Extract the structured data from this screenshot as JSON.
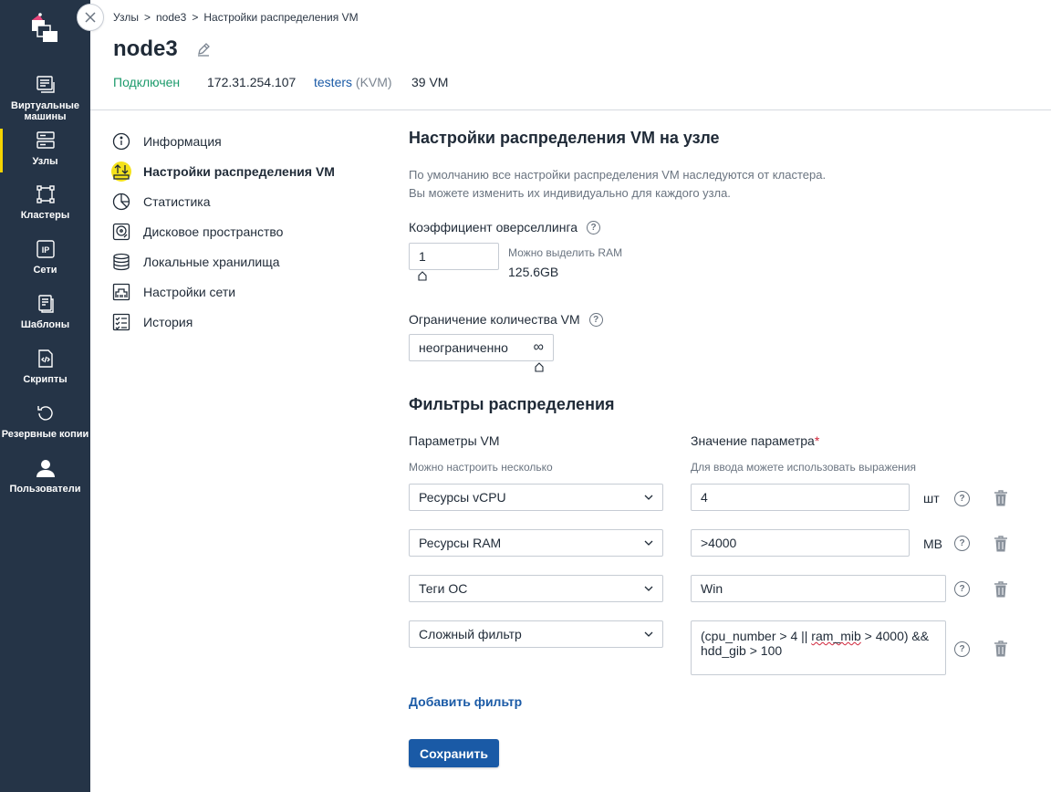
{
  "sidebar": {
    "items": [
      {
        "label": "Виртуальные машины",
        "icon": "vm-icon"
      },
      {
        "label": "Узлы",
        "icon": "nodes-icon",
        "active": true
      },
      {
        "label": "Кластеры",
        "icon": "clusters-icon"
      },
      {
        "label": "Сети",
        "icon": "ip-icon"
      },
      {
        "label": "Шаблоны",
        "icon": "templates-icon"
      },
      {
        "label": "Скрипты",
        "icon": "scripts-icon"
      },
      {
        "label": "Резервные копии",
        "icon": "backup-icon"
      },
      {
        "label": "Пользователи",
        "icon": "user-icon"
      }
    ]
  },
  "breadcrumb": {
    "items": [
      "Узлы",
      "node3",
      "Настройки распределения VM"
    ],
    "sep": ">"
  },
  "header": {
    "title": "node3",
    "status": "Подключен",
    "ip": "172.31.254.107",
    "cluster": "testers",
    "cluster_type": "(KVM)",
    "vm_count": "39 VM"
  },
  "menu": {
    "items": [
      {
        "label": "Информация",
        "icon": "info-icon"
      },
      {
        "label": "Настройки распределения VM",
        "icon": "distribution-icon",
        "active": true
      },
      {
        "label": "Статистика",
        "icon": "pie-chart-icon"
      },
      {
        "label": "Дисковое пространство",
        "icon": "disk-icon"
      },
      {
        "label": "Локальные хранилища",
        "icon": "database-icon"
      },
      {
        "label": "Настройки сети",
        "icon": "network-icon"
      },
      {
        "label": "История",
        "icon": "history-icon"
      }
    ]
  },
  "content": {
    "title": "Настройки распределения VM на узле",
    "desc_line1": "По умолчанию все настройки распределения VM наследуются от кластера.",
    "desc_line2": "Вы можете изменить их индивидуально для каждого узла.",
    "overselling_label": "Коэффициент оверселлинга",
    "overselling_value": "1",
    "ram_hint": "Можно выделить RAM",
    "ram_value": "125.6GB",
    "vm_limit_label": "Ограничение количества VM",
    "vm_limit_value": "неограниченно",
    "vm_limit_symbol": "∞",
    "filters_title": "Фильтры распределения",
    "col_params": "Параметры VM",
    "col_params_hint": "Можно настроить несколько",
    "col_value": "Значение параметра",
    "col_value_required": "*",
    "col_value_hint": "Для ввода можете использовать выражения",
    "filters": [
      {
        "param": "Ресурсы vCPU",
        "value": "4",
        "unit": "шт"
      },
      {
        "param": "Ресурсы RAM",
        "value": ">4000",
        "unit": "MB"
      },
      {
        "param": "Теги ОС",
        "value": "Win",
        "unit": ""
      },
      {
        "param": "Сложный фильтр",
        "value_part1": "(cpu_number > 4 || ",
        "value_squiggle": "ram_mib",
        "value_part2": " > 4000) &&",
        "value_line2": "hdd_gib > 100",
        "unit": ""
      }
    ],
    "add_filter": "Добавить фильтр",
    "save": "Сохранить",
    "help_symbol": "?"
  },
  "colors": {
    "sidebar": "#253447",
    "accent": "#1a5aa6",
    "active": "#f5d300",
    "status_ok": "#1d9b6c"
  }
}
